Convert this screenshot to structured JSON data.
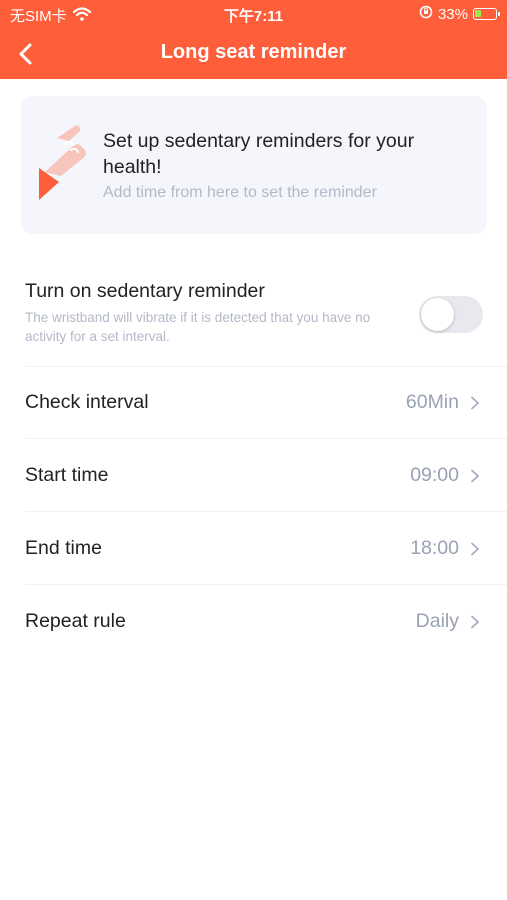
{
  "status_bar": {
    "carrier": "无SIM卡",
    "time": "下午7:11",
    "battery_percent": "33%",
    "battery_level": 0.33
  },
  "header": {
    "title": "Long seat reminder",
    "back_icon": "chevron-left-icon",
    "background_color": "#ff5e3a"
  },
  "banner": {
    "title": "Set up sedentary reminders for your health!",
    "subtitle": "Add time from here to set the reminder",
    "illustration_icon": "pointing-hand-icon"
  },
  "settings": {
    "reminder_toggle": {
      "label": "Turn on sedentary reminder",
      "description": "The wristband will vibrate if it is detected that you have no activity for a set interval.",
      "enabled": false
    },
    "items": [
      {
        "label": "Check interval",
        "value": "60Min"
      },
      {
        "label": "Start time",
        "value": "09:00"
      },
      {
        "label": "End time",
        "value": "18:00"
      },
      {
        "label": "Repeat rule",
        "value": "Daily"
      }
    ]
  }
}
